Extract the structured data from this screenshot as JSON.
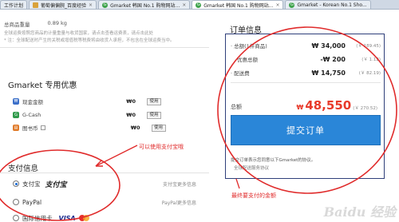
{
  "tabs": [
    {
      "label": "工作计划",
      "active": false
    },
    {
      "label": "葡萄偏偏腕_百度经验",
      "active": false
    },
    {
      "label": "Gmarket 韩国 No.1 购物网站...",
      "active": false
    },
    {
      "label": "Gmarket 韩国 No.1 购物网站...",
      "active": true
    },
    {
      "label": "Gmarket - Korean No.1 Sho...",
      "active": false
    }
  ],
  "shipping": {
    "weight_label": "总商品重量",
    "weight_value": "0.89 kg",
    "notice_1": "全球运费按照您商品的计量重量与收货国家，请点击查看运费表，请点击此处",
    "notice_2": "* 注：全球配送时产生的关税或增值税等税费将由收货人承担，不包含在全球运费当中。"
  },
  "coupons": {
    "title": "Gmarket 专用优惠",
    "items": [
      {
        "icon": "cash-icon",
        "name": "现金金额",
        "amount": "₩0",
        "button": "使用"
      },
      {
        "icon": "gcash-icon",
        "name": "G-Cash",
        "amount": "₩0",
        "button": "使用"
      },
      {
        "icon": "book-icon",
        "name": "图书币",
        "amount": "₩0",
        "button": "使用"
      }
    ]
  },
  "annotations": {
    "alipay_note": "可以使用支付宝哦",
    "total_note": "最终要支付的金额"
  },
  "payment": {
    "title": "支付信息",
    "options": [
      {
        "label": "支付宝",
        "logo": "支付宝",
        "right": "支付宝更多信息",
        "selected": true
      },
      {
        "label": "PayPal",
        "logo": "PayPal",
        "right": "PayPal更多信息",
        "selected": false
      },
      {
        "label": "国际信用卡",
        "logo": "VISA",
        "right": "",
        "selected": false
      }
    ]
  },
  "order": {
    "title": "订单信息",
    "rows": [
      {
        "label": "· 总额(1件商品)",
        "value": "₩ 34,000",
        "sub": "(￥ 189.45)"
      },
      {
        "label": "优惠总额",
        "value": "-₩ 200",
        "sub": "(￥ 1.12)"
      },
      {
        "label": "· 配送费",
        "value": "₩ 14,750",
        "sub": "(￥ 82.19)"
      }
    ],
    "total_label": "总额",
    "total_currency": "₩",
    "total_value": "48,550",
    "total_sub": "(￥ 270.52)",
    "submit_label": "提交订单",
    "agree_text": "提交订单表示您同意以下Gmarket的协议。",
    "agree_link": "全球配送服务协议"
  },
  "watermark": "Baidu 经验",
  "colors": {
    "accent_blue": "#2a86d8",
    "price_red": "#e83a2a",
    "annotation_red": "#e02b2b",
    "box_border": "#2f3f7a"
  }
}
